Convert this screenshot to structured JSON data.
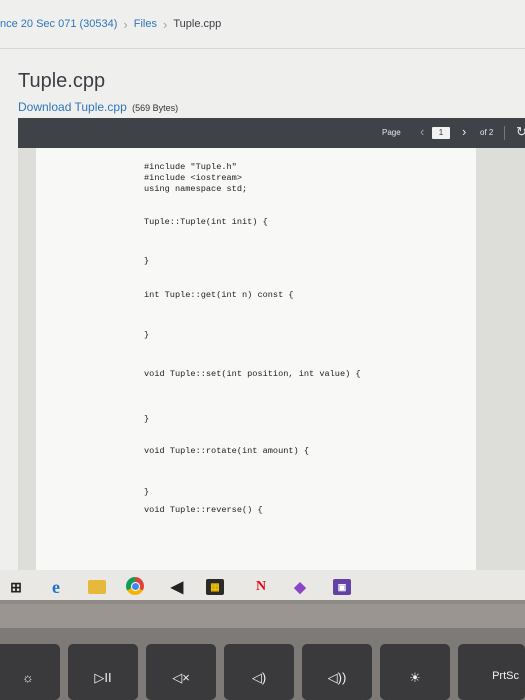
{
  "breadcrumb": {
    "course": "nce 20 Sec 071 (30534)",
    "files": "Files",
    "current": "Tuple.cpp",
    "separator": "›"
  },
  "file": {
    "title": "Tuple.cpp",
    "download_label": "Download Tuple.cpp",
    "size": "(569 Bytes)"
  },
  "viewer": {
    "page_label": "Page",
    "page_number": "1",
    "page_total": "of 2",
    "prev_glyph": "‹",
    "next_glyph": "›",
    "rotate_glyph": "↻"
  },
  "code": {
    "includes": "#include \"Tuple.h\"\n#include <iostream>\nusing namespace std;",
    "ctor_open": "Tuple::Tuple(int init) {",
    "ctor_close": "}",
    "get_open": "int Tuple::get(int n) const {",
    "get_close": "}",
    "set_open": "void Tuple::set(int position, int value) {",
    "set_close": "}",
    "rotate_open": "void Tuple::rotate(int amount) {",
    "rotate_close": "}",
    "reverse_open": "void Tuple::reverse() {"
  },
  "taskbar": {
    "icons": [
      "task-view-icon",
      "edge-icon",
      "file-explorer-icon",
      "chrome-icon",
      "mail-icon",
      "store-icon",
      "netflix-icon",
      "visual-studio-icon",
      "twitch-icon"
    ],
    "edge_glyph": "e",
    "netflix_glyph": "N",
    "taskview_glyph": "⊞",
    "mail_glyph": "◀",
    "vs_glyph": "◆",
    "twitch_glyph": "▣",
    "store_glyph": "▦"
  },
  "keyboard": {
    "keys": [
      "☼",
      "▷II",
      "◁×",
      "◁)",
      "◁))",
      "☀",
      "PrtSc"
    ]
  }
}
